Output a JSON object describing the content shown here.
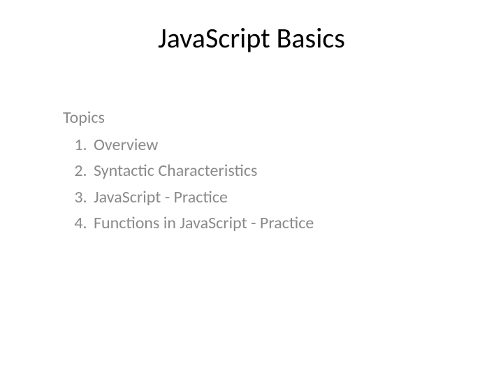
{
  "slide": {
    "title": "JavaScript Basics",
    "topics_label": "Topics",
    "topics": {
      "item1": "Overview",
      "item2": "Syntactic Characteristics",
      "item3": "JavaScript - Practice",
      "item4": "Functions in JavaScript - Practice"
    }
  }
}
